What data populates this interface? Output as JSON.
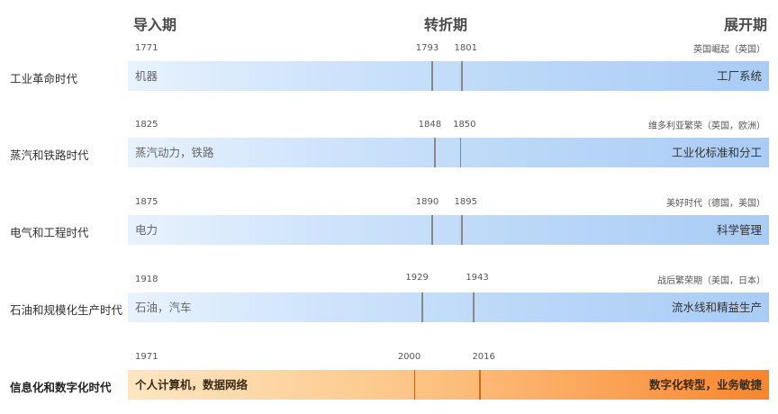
{
  "phases": [
    "导入期",
    "转折期",
    "展开期"
  ],
  "eras": [
    {
      "name": "工业革命时代",
      "start_year": "1771",
      "turn_years": [
        "1793",
        "1801"
      ],
      "note": "英国崛起（英国）",
      "left_text": "机器",
      "right_text": "工厂系统",
      "style": "blue",
      "tick_ratio": [
        0.474,
        0.52
      ]
    },
    {
      "name": "蒸汽和铁路时代",
      "start_year": "1825",
      "turn_years": [
        "1848",
        "1850"
      ],
      "note": "维多利亚繁荣（英国，欧洲）",
      "left_text": "蒸汽动力，铁路",
      "right_text": "工业化标准和分工",
      "style": "blue",
      "tick_ratio": [
        0.478,
        0.518
      ]
    },
    {
      "name": "电气和工程时代",
      "start_year": "1875",
      "turn_years": [
        "1890",
        "1895"
      ],
      "note": "美好时代（德国，美国）",
      "left_text": "电力",
      "right_text": "科学管理",
      "style": "blue",
      "tick_ratio": [
        0.474,
        0.52
      ]
    },
    {
      "name": "石油和规模化生产时代",
      "start_year": "1918",
      "turn_years": [
        "1929",
        "1943"
      ],
      "note": "战后繁荣期（美国，日本）",
      "left_text": "石油，汽车",
      "right_text": "流水线和精益生产",
      "style": "blue",
      "tick_ratio": [
        0.458,
        0.538
      ]
    },
    {
      "name": "信息化和数字化时代",
      "start_year": "1971",
      "turn_years": [
        "2000",
        "2016"
      ],
      "note": "",
      "left_text": "个人计算机，数据网络",
      "right_text": "数字化转型，业务敏捷",
      "style": "orange",
      "tick_ratio": [
        0.446,
        0.548
      ]
    }
  ]
}
